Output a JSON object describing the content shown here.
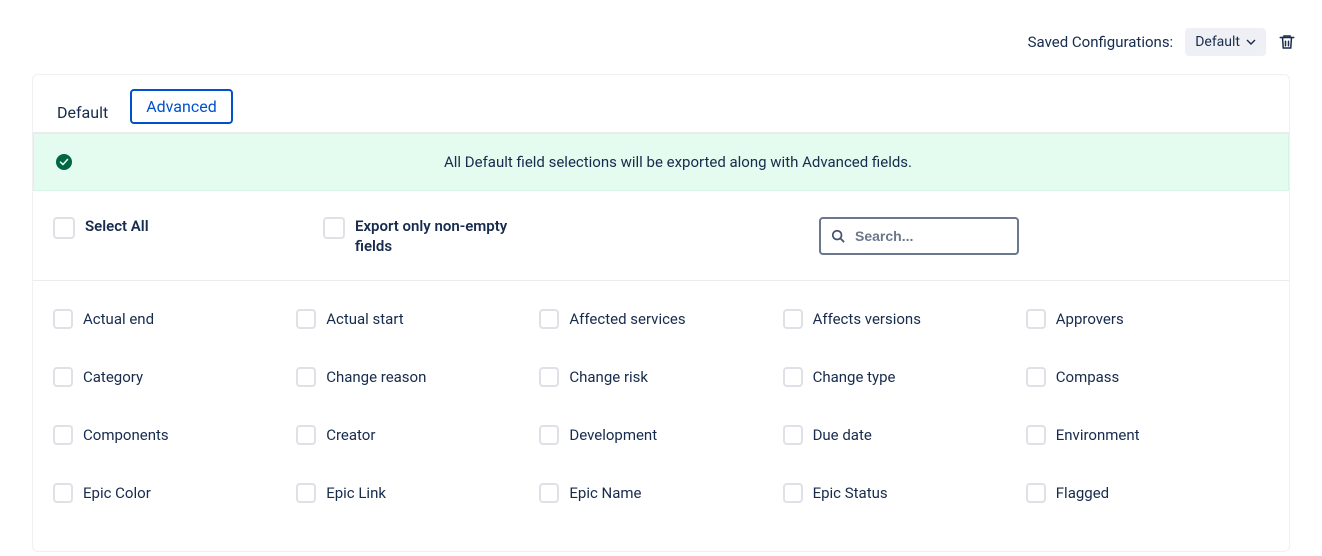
{
  "saved_configurations": {
    "label": "Saved Configurations:",
    "selected": "Default"
  },
  "tabs": {
    "default": "Default",
    "advanced": "Advanced"
  },
  "banner": "All Default field selections will be exported along with Advanced fields.",
  "controls": {
    "select_all": "Select All",
    "export_non_empty": "Export only non-empty fields",
    "search_placeholder": "Search..."
  },
  "fields": [
    [
      "Actual end",
      "Actual start",
      "Affected services",
      "Affects versions",
      "Approvers"
    ],
    [
      "Category",
      "Change reason",
      "Change risk",
      "Change type",
      "Compass"
    ],
    [
      "Components",
      "Creator",
      "Development",
      "Due date",
      "Environment"
    ],
    [
      "Epic Color",
      "Epic Link",
      "Epic Name",
      "Epic Status",
      "Flagged"
    ]
  ]
}
